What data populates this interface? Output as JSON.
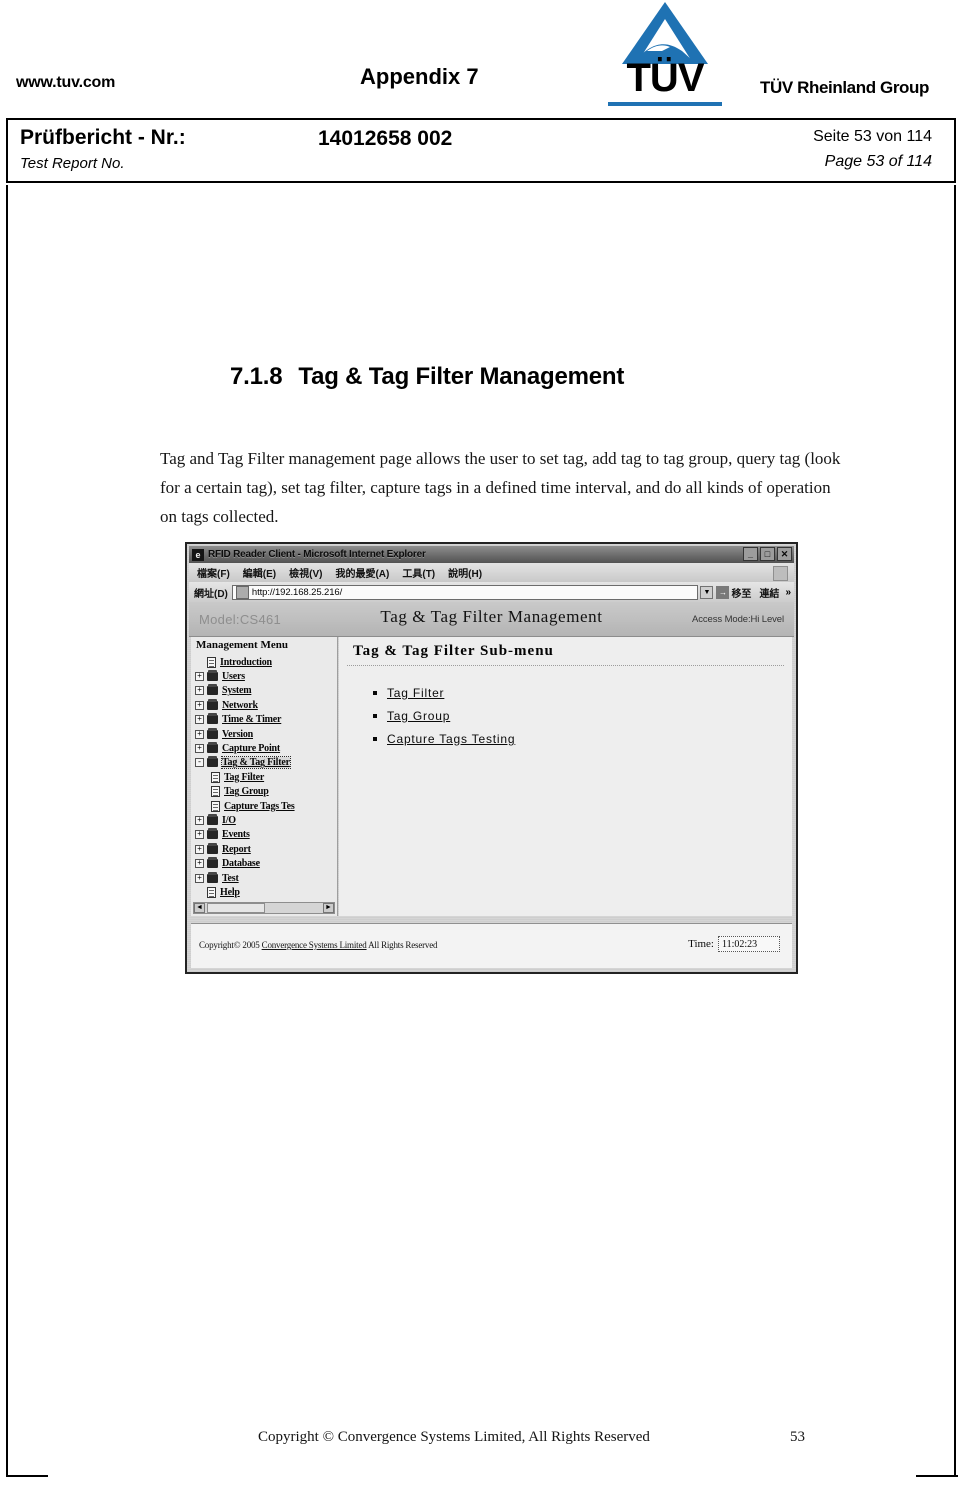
{
  "header": {
    "website": "www.tuv.com",
    "appendix_title": "Appendix 7",
    "brand_mark": "TÜV",
    "brand_group": "TÜV Rheinland Group",
    "brand_color": "#1f72b3"
  },
  "report_box": {
    "label_de": "Prüfbericht - Nr.:",
    "label_en": "Test Report No.",
    "report_number": "14012658 002",
    "page_de": "Seite 53 von 114",
    "page_en": "Page 53 of 114"
  },
  "section": {
    "number": "7.1.8",
    "title": "Tag & Tag Filter Management",
    "body": "Tag and Tag Filter management page allows the user to set tag, add tag to tag group, query tag (look for a certain tag), set tag filter, capture tags in a defined time interval, and do all kinds of operation on tags collected."
  },
  "browser": {
    "window_title": "RFID Reader Client - Microsoft Internet Explorer",
    "title_icon": "e-logo-icon",
    "window_buttons": [
      {
        "name": "minimize-button",
        "glyph": "_"
      },
      {
        "name": "maximize-button",
        "glyph": "□"
      },
      {
        "name": "close-button",
        "glyph": "✕"
      }
    ],
    "menu_items": [
      "檔案(F)",
      "編輯(E)",
      "檢視(V)",
      "我的最愛(A)",
      "工具(T)",
      "說明(H)"
    ],
    "address_label": "網址(D)",
    "address_value": "http://192.168.25.216/",
    "go_label": "移至",
    "links_label": "連結",
    "overflow_glyph": "»"
  },
  "app": {
    "model": "Model:CS461",
    "title": "Tag & Tag Filter Management",
    "access_mode": "Access Mode:Hi Level",
    "tree": {
      "title": "Management Menu",
      "items": [
        {
          "label": "Introduction",
          "level": 1,
          "icon": "page-icon",
          "expander": "",
          "selected": false
        },
        {
          "label": "Users",
          "level": 1,
          "icon": "folder-icon",
          "expander": "+",
          "selected": false
        },
        {
          "label": "System",
          "level": 1,
          "icon": "folder-icon",
          "expander": "+",
          "selected": false
        },
        {
          "label": "Network",
          "level": 1,
          "icon": "folder-icon",
          "expander": "+",
          "selected": false
        },
        {
          "label": "Time & Timer",
          "level": 1,
          "icon": "folder-icon",
          "expander": "+",
          "selected": false
        },
        {
          "label": "Version",
          "level": 1,
          "icon": "folder-icon",
          "expander": "+",
          "selected": false
        },
        {
          "label": "Capture Point",
          "level": 1,
          "icon": "folder-icon",
          "expander": "+",
          "selected": false
        },
        {
          "label": "Tag & Tag Filter",
          "level": 1,
          "icon": "folder-icon",
          "expander": "-",
          "selected": true
        },
        {
          "label": "Tag Filter",
          "level": 2,
          "icon": "page-icon",
          "expander": "",
          "selected": false
        },
        {
          "label": "Tag Group",
          "level": 2,
          "icon": "page-icon",
          "expander": "",
          "selected": false
        },
        {
          "label": "Capture Tags Tes",
          "level": 2,
          "icon": "page-icon",
          "expander": "",
          "selected": false
        },
        {
          "label": "I/O",
          "level": 1,
          "icon": "folder-icon",
          "expander": "+",
          "selected": false
        },
        {
          "label": "Events",
          "level": 1,
          "icon": "folder-icon",
          "expander": "+",
          "selected": false
        },
        {
          "label": "Report",
          "level": 1,
          "icon": "folder-icon",
          "expander": "+",
          "selected": false
        },
        {
          "label": "Database",
          "level": 1,
          "icon": "folder-icon",
          "expander": "+",
          "selected": false
        },
        {
          "label": "Test",
          "level": 1,
          "icon": "folder-icon",
          "expander": "+",
          "selected": false
        },
        {
          "label": "Help",
          "level": 1,
          "icon": "page-icon",
          "expander": "",
          "selected": false
        }
      ],
      "scroll_left_glyph": "◄",
      "scroll_right_glyph": "►"
    },
    "submenu": {
      "heading": "Tag  &  Tag  Filter  Sub-menu",
      "links": [
        "Tag  Filter",
        "Tag  Group",
        "Capture Tags  Testing"
      ]
    },
    "footer": {
      "copyright_pre": "Copyright© 2005 ",
      "copyright_link": "Convergence Systems Limited",
      "copyright_post": "  All Rights Reserved",
      "time_label": "Time:",
      "time_value": "11:02:23"
    }
  },
  "page_footer": {
    "copyright": "Copyright © Convergence Systems Limited, All Rights Reserved",
    "page_number": "53"
  }
}
